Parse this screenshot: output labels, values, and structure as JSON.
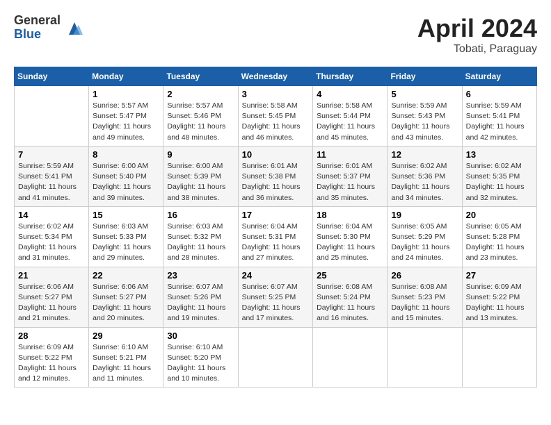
{
  "logo": {
    "general": "General",
    "blue": "Blue"
  },
  "title": {
    "month_year": "April 2024",
    "location": "Tobati, Paraguay"
  },
  "weekdays": [
    "Sunday",
    "Monday",
    "Tuesday",
    "Wednesday",
    "Thursday",
    "Friday",
    "Saturday"
  ],
  "weeks": [
    [
      {
        "num": "",
        "info": ""
      },
      {
        "num": "1",
        "info": "Sunrise: 5:57 AM\nSunset: 5:47 PM\nDaylight: 11 hours\nand 49 minutes."
      },
      {
        "num": "2",
        "info": "Sunrise: 5:57 AM\nSunset: 5:46 PM\nDaylight: 11 hours\nand 48 minutes."
      },
      {
        "num": "3",
        "info": "Sunrise: 5:58 AM\nSunset: 5:45 PM\nDaylight: 11 hours\nand 46 minutes."
      },
      {
        "num": "4",
        "info": "Sunrise: 5:58 AM\nSunset: 5:44 PM\nDaylight: 11 hours\nand 45 minutes."
      },
      {
        "num": "5",
        "info": "Sunrise: 5:59 AM\nSunset: 5:43 PM\nDaylight: 11 hours\nand 43 minutes."
      },
      {
        "num": "6",
        "info": "Sunrise: 5:59 AM\nSunset: 5:41 PM\nDaylight: 11 hours\nand 42 minutes."
      }
    ],
    [
      {
        "num": "7",
        "info": "Sunrise: 5:59 AM\nSunset: 5:41 PM\nDaylight: 11 hours\nand 41 minutes."
      },
      {
        "num": "8",
        "info": "Sunrise: 6:00 AM\nSunset: 5:40 PM\nDaylight: 11 hours\nand 39 minutes."
      },
      {
        "num": "9",
        "info": "Sunrise: 6:00 AM\nSunset: 5:39 PM\nDaylight: 11 hours\nand 38 minutes."
      },
      {
        "num": "10",
        "info": "Sunrise: 6:01 AM\nSunset: 5:38 PM\nDaylight: 11 hours\nand 36 minutes."
      },
      {
        "num": "11",
        "info": "Sunrise: 6:01 AM\nSunset: 5:37 PM\nDaylight: 11 hours\nand 35 minutes."
      },
      {
        "num": "12",
        "info": "Sunrise: 6:02 AM\nSunset: 5:36 PM\nDaylight: 11 hours\nand 34 minutes."
      },
      {
        "num": "13",
        "info": "Sunrise: 6:02 AM\nSunset: 5:35 PM\nDaylight: 11 hours\nand 32 minutes."
      }
    ],
    [
      {
        "num": "14",
        "info": "Sunrise: 6:02 AM\nSunset: 5:34 PM\nDaylight: 11 hours\nand 31 minutes."
      },
      {
        "num": "15",
        "info": "Sunrise: 6:03 AM\nSunset: 5:33 PM\nDaylight: 11 hours\nand 29 minutes."
      },
      {
        "num": "16",
        "info": "Sunrise: 6:03 AM\nSunset: 5:32 PM\nDaylight: 11 hours\nand 28 minutes."
      },
      {
        "num": "17",
        "info": "Sunrise: 6:04 AM\nSunset: 5:31 PM\nDaylight: 11 hours\nand 27 minutes."
      },
      {
        "num": "18",
        "info": "Sunrise: 6:04 AM\nSunset: 5:30 PM\nDaylight: 11 hours\nand 25 minutes."
      },
      {
        "num": "19",
        "info": "Sunrise: 6:05 AM\nSunset: 5:29 PM\nDaylight: 11 hours\nand 24 minutes."
      },
      {
        "num": "20",
        "info": "Sunrise: 6:05 AM\nSunset: 5:28 PM\nDaylight: 11 hours\nand 23 minutes."
      }
    ],
    [
      {
        "num": "21",
        "info": "Sunrise: 6:06 AM\nSunset: 5:27 PM\nDaylight: 11 hours\nand 21 minutes."
      },
      {
        "num": "22",
        "info": "Sunrise: 6:06 AM\nSunset: 5:27 PM\nDaylight: 11 hours\nand 20 minutes."
      },
      {
        "num": "23",
        "info": "Sunrise: 6:07 AM\nSunset: 5:26 PM\nDaylight: 11 hours\nand 19 minutes."
      },
      {
        "num": "24",
        "info": "Sunrise: 6:07 AM\nSunset: 5:25 PM\nDaylight: 11 hours\nand 17 minutes."
      },
      {
        "num": "25",
        "info": "Sunrise: 6:08 AM\nSunset: 5:24 PM\nDaylight: 11 hours\nand 16 minutes."
      },
      {
        "num": "26",
        "info": "Sunrise: 6:08 AM\nSunset: 5:23 PM\nDaylight: 11 hours\nand 15 minutes."
      },
      {
        "num": "27",
        "info": "Sunrise: 6:09 AM\nSunset: 5:22 PM\nDaylight: 11 hours\nand 13 minutes."
      }
    ],
    [
      {
        "num": "28",
        "info": "Sunrise: 6:09 AM\nSunset: 5:22 PM\nDaylight: 11 hours\nand 12 minutes."
      },
      {
        "num": "29",
        "info": "Sunrise: 6:10 AM\nSunset: 5:21 PM\nDaylight: 11 hours\nand 11 minutes."
      },
      {
        "num": "30",
        "info": "Sunrise: 6:10 AM\nSunset: 5:20 PM\nDaylight: 11 hours\nand 10 minutes."
      },
      {
        "num": "",
        "info": ""
      },
      {
        "num": "",
        "info": ""
      },
      {
        "num": "",
        "info": ""
      },
      {
        "num": "",
        "info": ""
      }
    ]
  ]
}
